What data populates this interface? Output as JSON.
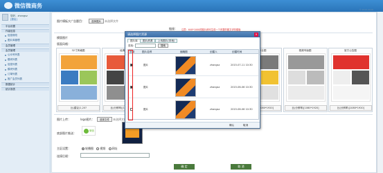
{
  "header": {
    "brand": "微信微商务",
    "copyright": "© 2014-2016"
  },
  "sidebar": {
    "user": "您好，zhangsz",
    "logout": "[退出]",
    "items": [
      {
        "label": "平台设置",
        "type": "group"
      },
      {
        "label": "作者信息",
        "type": "group"
      },
      {
        "label": "信息修改",
        "type": "sub"
      },
      {
        "label": "图片库管理",
        "type": "sub"
      },
      {
        "label": "会员管理",
        "type": "group"
      },
      {
        "label": "会员管理",
        "type": "group"
      },
      {
        "label": "公众号列表",
        "type": "sub"
      },
      {
        "label": "模块列表",
        "type": "sub"
      },
      {
        "label": "信息列表",
        "type": "sub"
      },
      {
        "label": "模块列表",
        "type": "sub"
      },
      {
        "label": "订单列表",
        "type": "sub"
      },
      {
        "label": "推广会员列表",
        "type": "sub"
      },
      {
        "label": "数据统计",
        "type": "group"
      },
      {
        "label": "统计报表",
        "type": "group"
      }
    ]
  },
  "form": {
    "top_label": "图片模板大广告题目：",
    "top_button": "选择图片",
    "top_placeholder": "未选择文件",
    "url_label": "链接：",
    "hint": "注意：640*1000的图片即可生成一个完整的图文详情模板",
    "section_label": "模版图片",
    "layout_label": "版面风格：",
    "logo_label": "图片上传：",
    "logo_sub": "logo图片：",
    "logo_button": "选择文件",
    "logo_placeholder": "未选择文件",
    "qr_label": "底部图片推送：",
    "qr_text": "微信",
    "slide_label": "主区设置：",
    "slide_options": [
      "轮播图",
      "视频",
      "网址"
    ],
    "link_label": "连接后缀：",
    "confirm": "确 定",
    "cancel": "取 消"
  },
  "cards": [
    {
      "title": "32寸风格图",
      "size": "比(建议)1,20?"
    },
    {
      "title": "经典图",
      "size": "比(分辨率)[1080*1920]"
    },
    {
      "title": "经典图",
      "size": "比(分辨率)[1080*1920]"
    },
    {
      "title": "经典图",
      "size": "比(分辨率)[1080*1920]"
    },
    {
      "title": "32寸专业图",
      "size": "比(分辨率)[1080*1920]"
    },
    {
      "title": "视频专版图",
      "size": "比(分辨率)[1080*1920]"
    },
    {
      "title": "官方公告图",
      "size": "比(分辨率)[1080*1920]"
    }
  ],
  "modal": {
    "title": "请选择图片资源",
    "close": "×",
    "tabs": [
      "图片库",
      "图片资源",
      "上传图片(本地)"
    ],
    "search_label": "查找：",
    "search_button": "搜索",
    "columns": [
      "选择",
      "图片名称",
      "缩略图",
      "创建人",
      "创建时间"
    ],
    "rows": [
      {
        "name": "图片",
        "creator": "zhangsz",
        "date": "2015-07-11 10:30"
      },
      {
        "name": "图片",
        "creator": "zhangsz",
        "date": "2015-06-06 10:30"
      },
      {
        "name": "图片",
        "creator": "zhangsz",
        "date": "2015-06-06 10:30"
      }
    ],
    "footer": [
      "确认",
      "取消"
    ]
  }
}
